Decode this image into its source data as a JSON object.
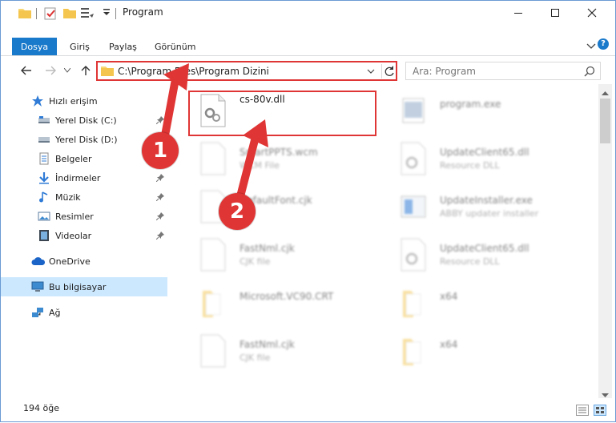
{
  "window": {
    "title": "Program",
    "colors": {
      "accent": "#1979ca",
      "highlight": "#e03535",
      "selected_bg": "#cce8ff"
    }
  },
  "ribbon": {
    "tabs": [
      "Dosya",
      "Giriş",
      "Paylaş",
      "Görünüm"
    ]
  },
  "address": {
    "path": "C:\\Program Files\\Program Dizini"
  },
  "search": {
    "placeholder": "Ara: Program"
  },
  "sidebar": {
    "items": [
      {
        "label": "Hızlı erişim",
        "icon": "star-icon"
      },
      {
        "label": "Yerel Disk (C:)",
        "icon": "drive-icon",
        "pinned": true
      },
      {
        "label": "Yerel Disk (D:)",
        "icon": "drive-icon"
      },
      {
        "label": "Belgeler",
        "icon": "documents-icon"
      },
      {
        "label": "İndirmeler",
        "icon": "downloads-icon",
        "pinned": true
      },
      {
        "label": "Müzik",
        "icon": "music-icon",
        "pinned": true
      },
      {
        "label": "Resimler",
        "icon": "pictures-icon",
        "pinned": true
      },
      {
        "label": "Videolar",
        "icon": "videos-icon",
        "pinned": true
      },
      {
        "label": "OneDrive",
        "icon": "cloud-icon"
      },
      {
        "label": "Bu bilgisayar",
        "icon": "computer-icon",
        "selected": true
      },
      {
        "label": "Ağ",
        "icon": "network-icon"
      }
    ]
  },
  "files": {
    "highlighted": {
      "name": "cs-80v.dll",
      "type": ""
    },
    "items": [
      {
        "name": "program.exe",
        "type": ""
      },
      {
        "name": "SmartPPTS.wcm",
        "type": "WCM File"
      },
      {
        "name": "UpdateClient65.dll",
        "type": "Resource DLL"
      },
      {
        "name": "DefaultFont.cjk",
        "type": ""
      },
      {
        "name": "UpdateInstaller.exe",
        "type": "ABBY updater installer"
      },
      {
        "name": "FastNml.cjk",
        "type": "CJK file"
      },
      {
        "name": "UpdateClient65.dll",
        "type": "Resource DLL"
      },
      {
        "name": "Microsoft.VC90.CRT",
        "type": ""
      },
      {
        "name": "x64",
        "type": ""
      },
      {
        "name": "FastNml.cjk",
        "type": "CJK file"
      },
      {
        "name": "x64",
        "type": ""
      }
    ]
  },
  "status": {
    "count": "194 öğe"
  },
  "annotations": {
    "step1": "1",
    "step2": "2"
  }
}
